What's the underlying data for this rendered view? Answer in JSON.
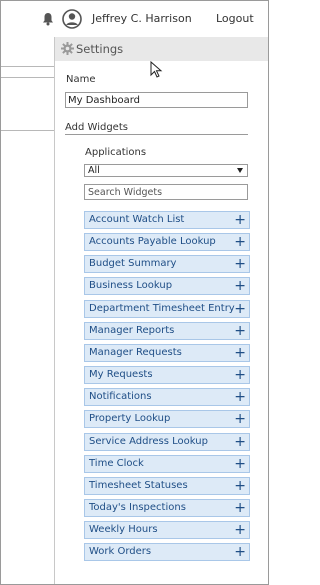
{
  "header": {
    "user_name": "Jeffrey C. Harrison",
    "logout_label": "Logout",
    "icons": [
      "bell-icon",
      "user-avatar-icon"
    ]
  },
  "settings": {
    "title": "Settings",
    "name_label": "Name",
    "name_value": "My Dashboard",
    "add_widgets_label": "Add Widgets",
    "applications_label": "Applications",
    "applications_selected": "All",
    "search_placeholder": "Search Widgets",
    "widgets": [
      {
        "label": "Account Watch List"
      },
      {
        "label": "Accounts Payable Lookup"
      },
      {
        "label": "Budget Summary"
      },
      {
        "label": "Business Lookup"
      },
      {
        "label": "Department Timesheet Entry"
      },
      {
        "label": "Manager Reports"
      },
      {
        "label": "Manager Requests"
      },
      {
        "label": "My Requests"
      },
      {
        "label": "Notifications"
      },
      {
        "label": "Property Lookup"
      },
      {
        "label": "Service Address Lookup"
      },
      {
        "label": "Time Clock"
      },
      {
        "label": "Timesheet Statuses"
      },
      {
        "label": "Today's Inspections"
      },
      {
        "label": "Weekly Hours"
      },
      {
        "label": "Work Orders"
      }
    ],
    "add_icon": "+"
  },
  "colors": {
    "widget_bg": "#ddeaf7",
    "widget_border": "#a9c7e8",
    "widget_text": "#1f4e86",
    "header_bg": "#e8e8e8"
  }
}
